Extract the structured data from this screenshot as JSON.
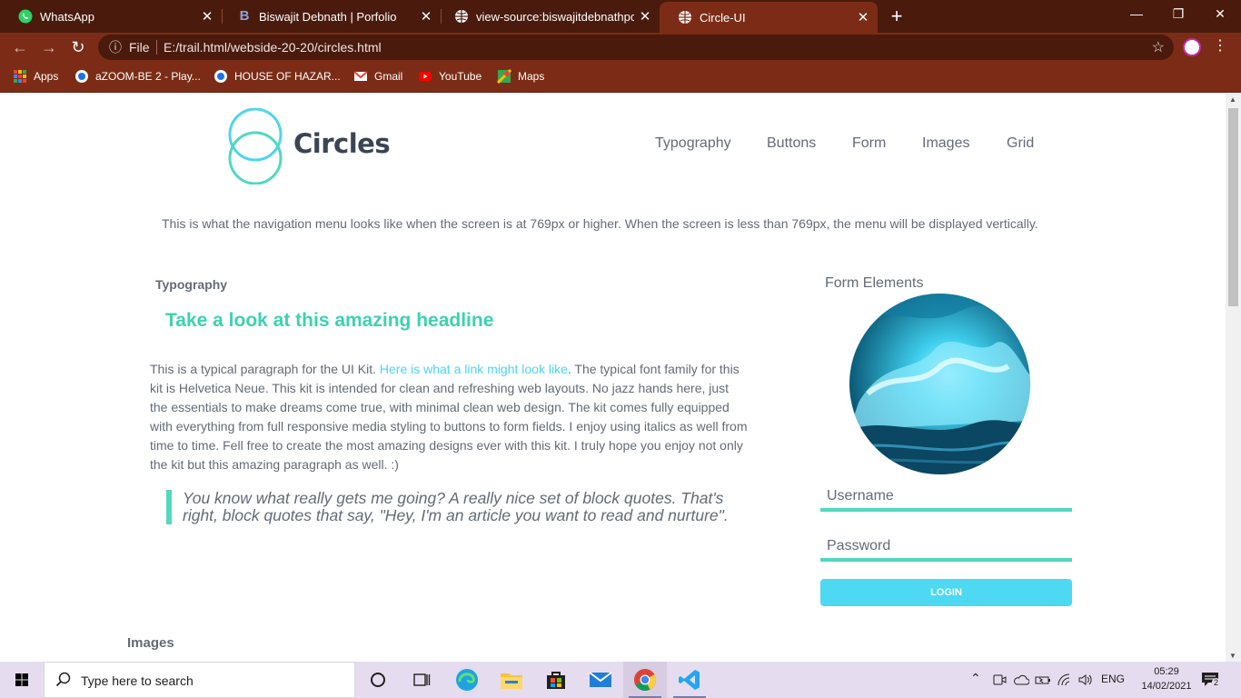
{
  "browser": {
    "tabs": [
      {
        "title": "WhatsApp",
        "icon": "whatsapp-icon"
      },
      {
        "title": "Biswajit Debnath | Porfolio",
        "icon": "b-letter-icon"
      },
      {
        "title": "view-source:biswajitdebnathportf",
        "icon": "globe-icon"
      },
      {
        "title": "Circle-UI",
        "icon": "globe-icon",
        "active": true
      }
    ],
    "new_tab_glyph": "+",
    "window_controls": {
      "minimize": "—",
      "restore": "❐",
      "close": "✕"
    },
    "close_glyph": "✕",
    "nav": {
      "back": "←",
      "forward": "→",
      "reload": "↻",
      "info": "ⓘ",
      "star": "☆",
      "menu": "⋮"
    },
    "address": {
      "scheme": "File",
      "url": "E:/trail.html/webside-20-20/circles.html"
    },
    "bookmarks": [
      {
        "label": "Apps",
        "icon": "apps-grid-icon"
      },
      {
        "label": "aZOOM-BE 2 - Play...",
        "icon": "disc-icon"
      },
      {
        "label": "HOUSE OF HAZAR...",
        "icon": "disc-icon"
      },
      {
        "label": "Gmail",
        "icon": "gmail-icon"
      },
      {
        "label": "YouTube",
        "icon": "youtube-icon"
      },
      {
        "label": "Maps",
        "icon": "maps-icon"
      }
    ]
  },
  "page": {
    "brand": "Circles",
    "nav": [
      "Typography",
      "Buttons",
      "Form",
      "Images",
      "Grid"
    ],
    "note": "This is what the navigation menu looks like when the screen is at 769px or higher. When the screen is less than 769px, the menu will be displayed vertically.",
    "typography": {
      "label": "Typography",
      "headline": "Take a look at this amazing headline",
      "para_before_link": "This is a typical paragraph for the UI Kit. ",
      "link_text": "Here is what a link might look like",
      "para_after_link": ". The typical font family for this kit is Helvetica Neue. This kit is intended for clean and refreshing web layouts. No jazz hands here, just the essentials to make dreams come true, with minimal clean web design. The kit comes fully equipped with everything from full responsive media styling to buttons to form fields. I enjoy using italics as well from time to time. Fell free to create the most amazing designs ever with this kit. I truly hope you enjoy not only the kit but this amazing paragraph as well. :)",
      "quote": "You know what really gets me going? A really nice set of block quotes. That's right, block quotes that say, \"Hey, I'm an article you want to read and nurture\"."
    },
    "form": {
      "title": "Form Elements",
      "username_placeholder": "Username",
      "password_placeholder": "Password",
      "login_label": "LOGIN"
    },
    "images_label": "Images",
    "colors": {
      "accent_green": "#3ed1b0",
      "accent_cyan": "#4ed9f3",
      "text": "#636b76"
    }
  },
  "taskbar": {
    "search_placeholder": "Type here to search",
    "language": "ENG",
    "time": "05:29",
    "date": "14/02/2021",
    "notification_count": "2"
  }
}
